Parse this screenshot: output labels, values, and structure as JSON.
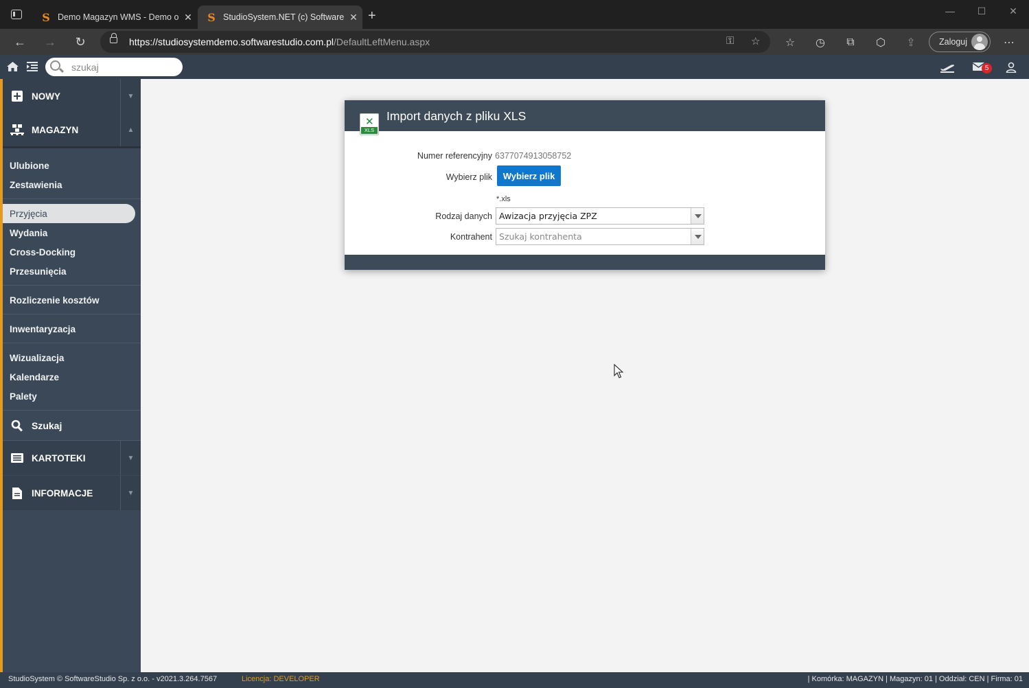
{
  "browser": {
    "tabs": [
      {
        "title": "Demo Magazyn WMS - Demo on",
        "favicon": "S"
      },
      {
        "title": "StudioSystem.NET (c) SoftwareSt",
        "favicon": "S"
      }
    ],
    "url_host": "https://studiosystemdemo.softwarestudio.com.pl",
    "url_path": "/DefaultLeftMenu.aspx",
    "login_label": "Zaloguj"
  },
  "topbar": {
    "search_placeholder": "szukaj",
    "mail_count": "5"
  },
  "sidebar": {
    "sections": {
      "nowy": "NOWY",
      "magazyn": "MAGAZYN",
      "kartoteki": "KARTOTEKI",
      "informacje": "INFORMACJE"
    },
    "groups": [
      [
        "Ulubione",
        "Zestawienia"
      ],
      [
        "Przyjęcia",
        "Wydania",
        "Cross-Docking",
        "Przesunięcia"
      ],
      [
        "Rozliczenie kosztów"
      ],
      [
        "Inwentaryzacja"
      ],
      [
        "Wizualizacja",
        "Kalendarze",
        "Palety"
      ]
    ],
    "active_item": "Przyjęcia",
    "search_label": "Szukaj"
  },
  "dialog": {
    "title": "Import danych z pliku XLS",
    "icon_text": "XLS",
    "ref_label": "Numer referencyjny",
    "ref_value": "6377074913058752",
    "file_label": "Wybierz plik",
    "file_button": "Wybierz plik",
    "file_ext": "*.xls",
    "type_label": "Rodzaj danych",
    "type_value": "Awizacja przyjęcia ZPZ",
    "contractor_label": "Kontrahent",
    "contractor_placeholder": "Szukaj kontrahenta"
  },
  "status": {
    "left": "StudioSystem © SoftwareStudio Sp. z o.o. - v2021.3.264.7567",
    "license": "Licencja: DEVELOPER",
    "right": "| Komórka: MAGAZYN | Magazyn: 01 | Oddział: CEN | Firma: 01"
  },
  "colors": {
    "accent_orange": "#e29a24",
    "sidebar_bg": "#3a4857",
    "header_bg": "#34404d",
    "button_blue": "#1177cc",
    "badge_red": "#d9262b"
  }
}
